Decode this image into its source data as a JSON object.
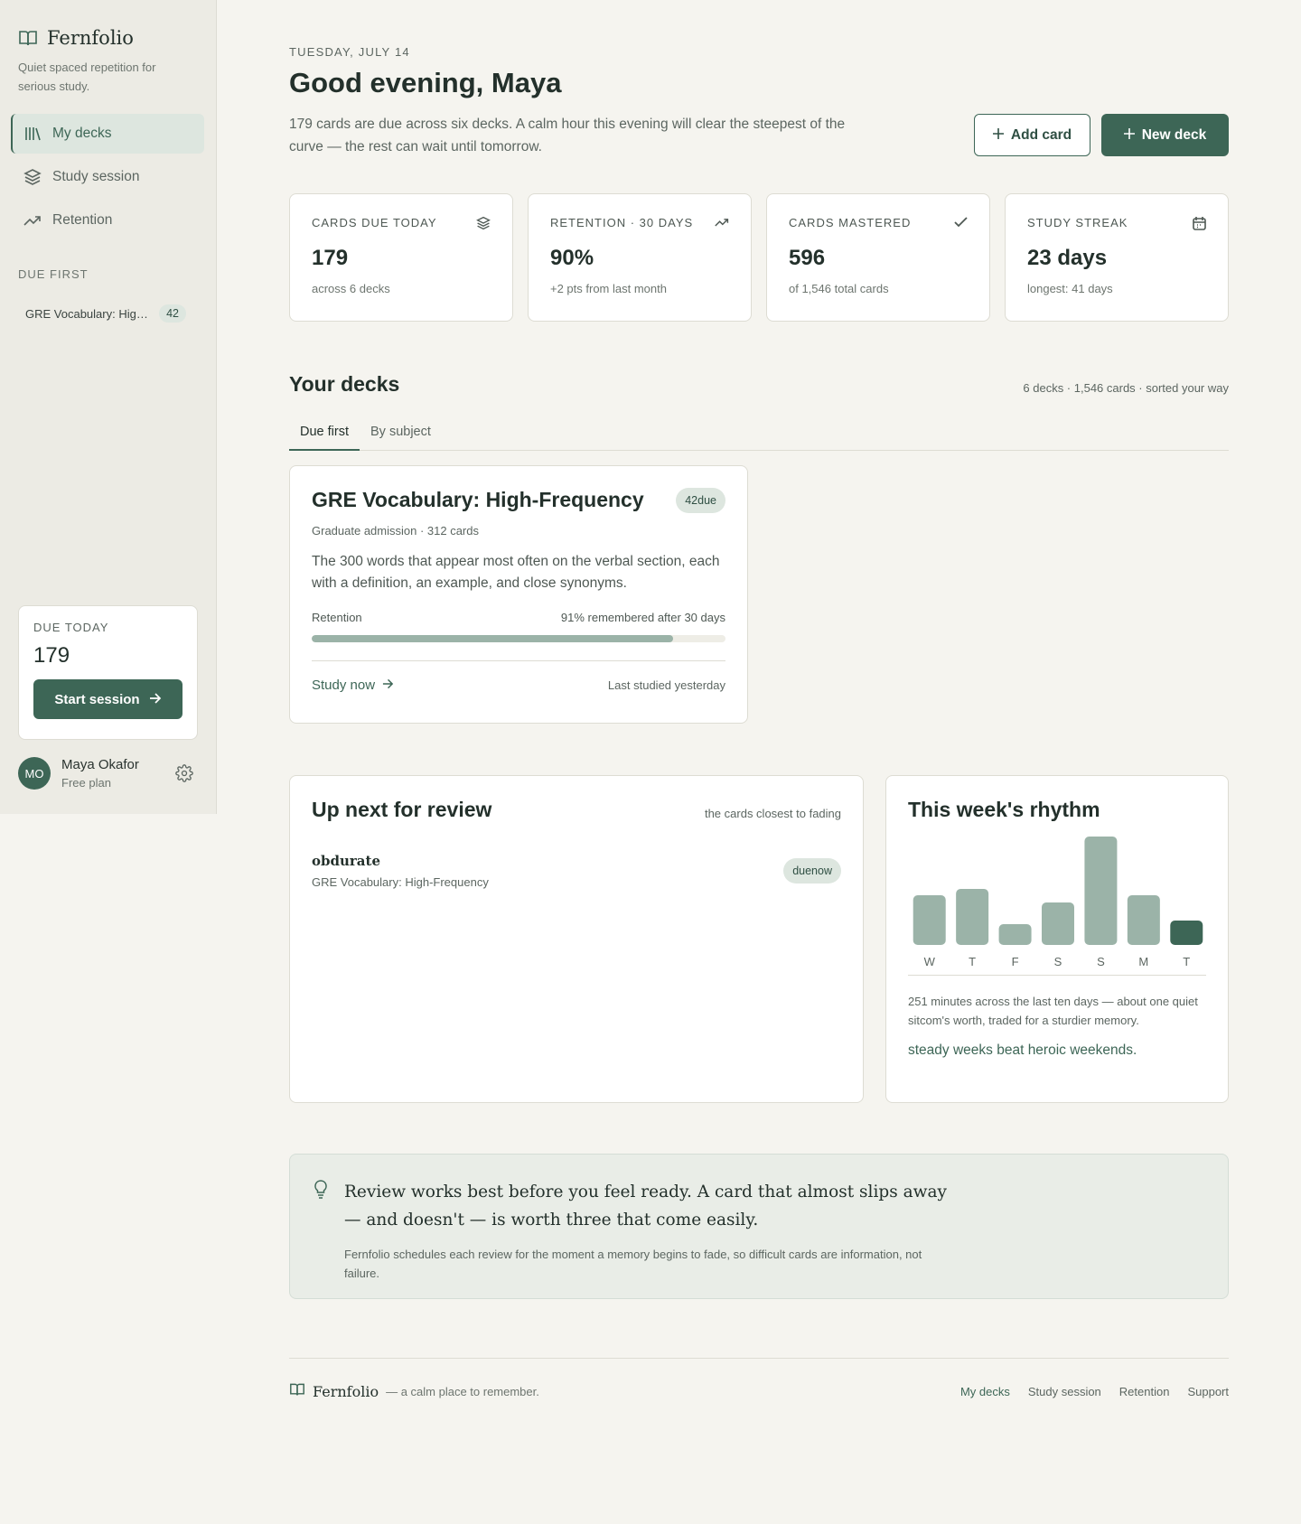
{
  "brand": {
    "name": "Fernfolio",
    "tagline": "Quiet spaced repetition for serious study."
  },
  "nav": [
    {
      "label": "My decks",
      "icon": "library-icon",
      "active": true
    },
    {
      "label": "Study session",
      "icon": "layers-icon"
    },
    {
      "label": "Retention",
      "icon": "trend-up-icon"
    }
  ],
  "sidebar": {
    "due_first_label": "DUE FIRST",
    "due_items": [
      {
        "name": "GRE Vocabulary: High-Frequency",
        "count": "42"
      }
    ],
    "due_card": {
      "label": "DUE TODAY",
      "value": "179",
      "button": "Start session"
    },
    "user": {
      "initials": "MO",
      "name": "Maya Okafor",
      "plan": "Free plan"
    }
  },
  "header": {
    "date": "TUESDAY, JULY 14",
    "greeting": "Good evening, Maya",
    "intro": "179 cards are due across six decks. A calm hour this evening will clear the steepest of the curve — the rest can wait until tomorrow.",
    "add_card": "Add card",
    "new_deck": "New deck"
  },
  "stats": [
    {
      "label": "CARDS DUE TODAY",
      "value": "179",
      "sub": "across 6 decks",
      "icon": "layers-icon"
    },
    {
      "label": "RETENTION · 30 DAYS",
      "value": "90%",
      "sub": "+2 pts from last month",
      "icon": "trend-up-icon"
    },
    {
      "label": "CARDS MASTERED",
      "value": "596",
      "sub": "of 1,546 total cards",
      "icon": "check-icon"
    },
    {
      "label": "STUDY STREAK",
      "value": "23 days",
      "sub": "longest: 41 days",
      "icon": "calendar-icon"
    }
  ],
  "decks": {
    "title": "Your decks",
    "meta": "6 decks · 1,546 cards · sorted your way",
    "tabs": [
      "Due first",
      "By subject"
    ],
    "cards": [
      {
        "title": "GRE Vocabulary: High-Frequency",
        "badge": "42due",
        "subtitle": "Graduate admission · 312 cards",
        "description": "The 300 words that appear most often on the verbal section, each with a definition, an example, and close synonyms.",
        "retention_label": "Retention",
        "retention_text": "91% remembered after 30 days",
        "retention_value": 0.91,
        "study_link": "Study now",
        "last_studied": "Last studied yesterday"
      }
    ]
  },
  "review": {
    "title": "Up next for review",
    "meta": "the cards closest to fading",
    "items": [
      {
        "word": "obdurate",
        "deck": "GRE Vocabulary: High-Frequency",
        "badge": "duenow"
      }
    ]
  },
  "rhythm": {
    "title": "This week's rhythm",
    "text": "251 minutes across the last ten days — about one quiet sitcom's worth, traded for a sturdier memory.",
    "quote": "steady weeks beat heroic weekends."
  },
  "chart_data": {
    "type": "bar",
    "categories": [
      "W",
      "T",
      "F",
      "S",
      "S",
      "M",
      "T"
    ],
    "values": [
      55,
      62,
      23,
      47,
      120,
      55,
      27
    ],
    "highlight_index": 6,
    "colors": {
      "bar": "#9bb3a8",
      "highlight": "#3d6656"
    }
  },
  "tip": {
    "quote": "Review works best before you feel ready. A card that almost slips away — and doesn't — is worth three that come easily.",
    "sub": "Fernfolio schedules each review for the moment a memory begins to fade, so difficult cards are information, not failure."
  },
  "footer": {
    "brand": "Fernfolio",
    "tagline": "— a calm place to remember.",
    "links": [
      "My decks",
      "Study session",
      "Retention",
      "Support"
    ]
  },
  "colors": {
    "accent": "#3d6656",
    "background": "#f5f4ef",
    "sidebar": "#ecebe4"
  }
}
